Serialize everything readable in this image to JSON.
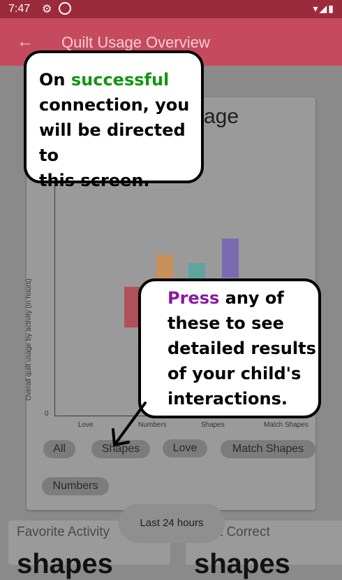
{
  "status_bar": {
    "time": "7:47"
  },
  "app_bar": {
    "title": "Quilt Usage Overview",
    "back_icon": "arrow-left-icon"
  },
  "card": {
    "title_partial": "age"
  },
  "chart_data": {
    "type": "bar",
    "title": "",
    "ylabel": "Overall quilt usage by activity (in hours)",
    "xlabel": "",
    "categories": [
      "Love",
      "Numbers",
      "Shapes",
      "Match Shapes"
    ],
    "tick_labels": {
      "zero": "0",
      "x": [
        "Love",
        "Numbers",
        "Shapes",
        "Match Shapes"
      ]
    },
    "series": [
      {
        "color": "#b0505a"
      },
      {
        "color": "#c8905a"
      },
      {
        "color": "#5ea59d"
      },
      {
        "color": "#7a6bb0"
      }
    ]
  },
  "chips": [
    {
      "label": "All"
    },
    {
      "label": "Shapes"
    },
    {
      "label": "Love"
    },
    {
      "label": "Match Shapes"
    },
    {
      "label": "Numbers"
    }
  ],
  "toast": {
    "label": "Last 24 hours"
  },
  "bottom_cards": [
    {
      "label": "Favorite Activity",
      "value": "shapes"
    },
    {
      "label": "Most Correct",
      "value": "shapes"
    }
  ],
  "tips": {
    "top": {
      "highlight": "successful",
      "line1_prefix": "On",
      "rest": [
        "connection, you",
        "will be directed to",
        "this screen."
      ]
    },
    "bottom": {
      "highlight": "Press",
      "line1_suffix": "any of",
      "rest": [
        "these to see",
        "detailed results",
        "of your child's",
        "interactions."
      ]
    }
  },
  "colors": {
    "status_bar": "#9b2a3b",
    "app_bar": "#c64a5e",
    "highlight_green": "#129512",
    "highlight_purple": "#8a1aa6"
  }
}
